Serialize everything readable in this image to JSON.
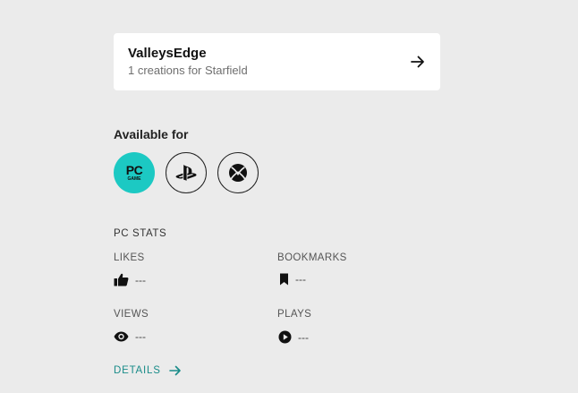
{
  "author": {
    "name": "ValleysEdge",
    "subtitle": "1 creations for Starfield"
  },
  "available": {
    "title": "Available for",
    "platforms": [
      {
        "name": "PC GAME",
        "main": "PC",
        "sub": "GAME",
        "icon": "pc-game-icon",
        "color": "#1cc9c3"
      },
      {
        "name": "PlayStation",
        "icon": "playstation-icon"
      },
      {
        "name": "Xbox",
        "icon": "xbox-icon"
      }
    ]
  },
  "stats": {
    "title": "PC STATS",
    "likes": {
      "label": "LIKES",
      "value": "---",
      "icon": "thumbs-up-icon"
    },
    "bookmarks": {
      "label": "BOOKMARKS",
      "value": "---",
      "icon": "bookmark-icon"
    },
    "views": {
      "label": "VIEWS",
      "value": "---",
      "icon": "eye-icon"
    },
    "plays": {
      "label": "PLAYS",
      "value": "---",
      "icon": "play-circle-icon"
    }
  },
  "details": {
    "label": "DETAILS",
    "color": "#1a8c89"
  }
}
